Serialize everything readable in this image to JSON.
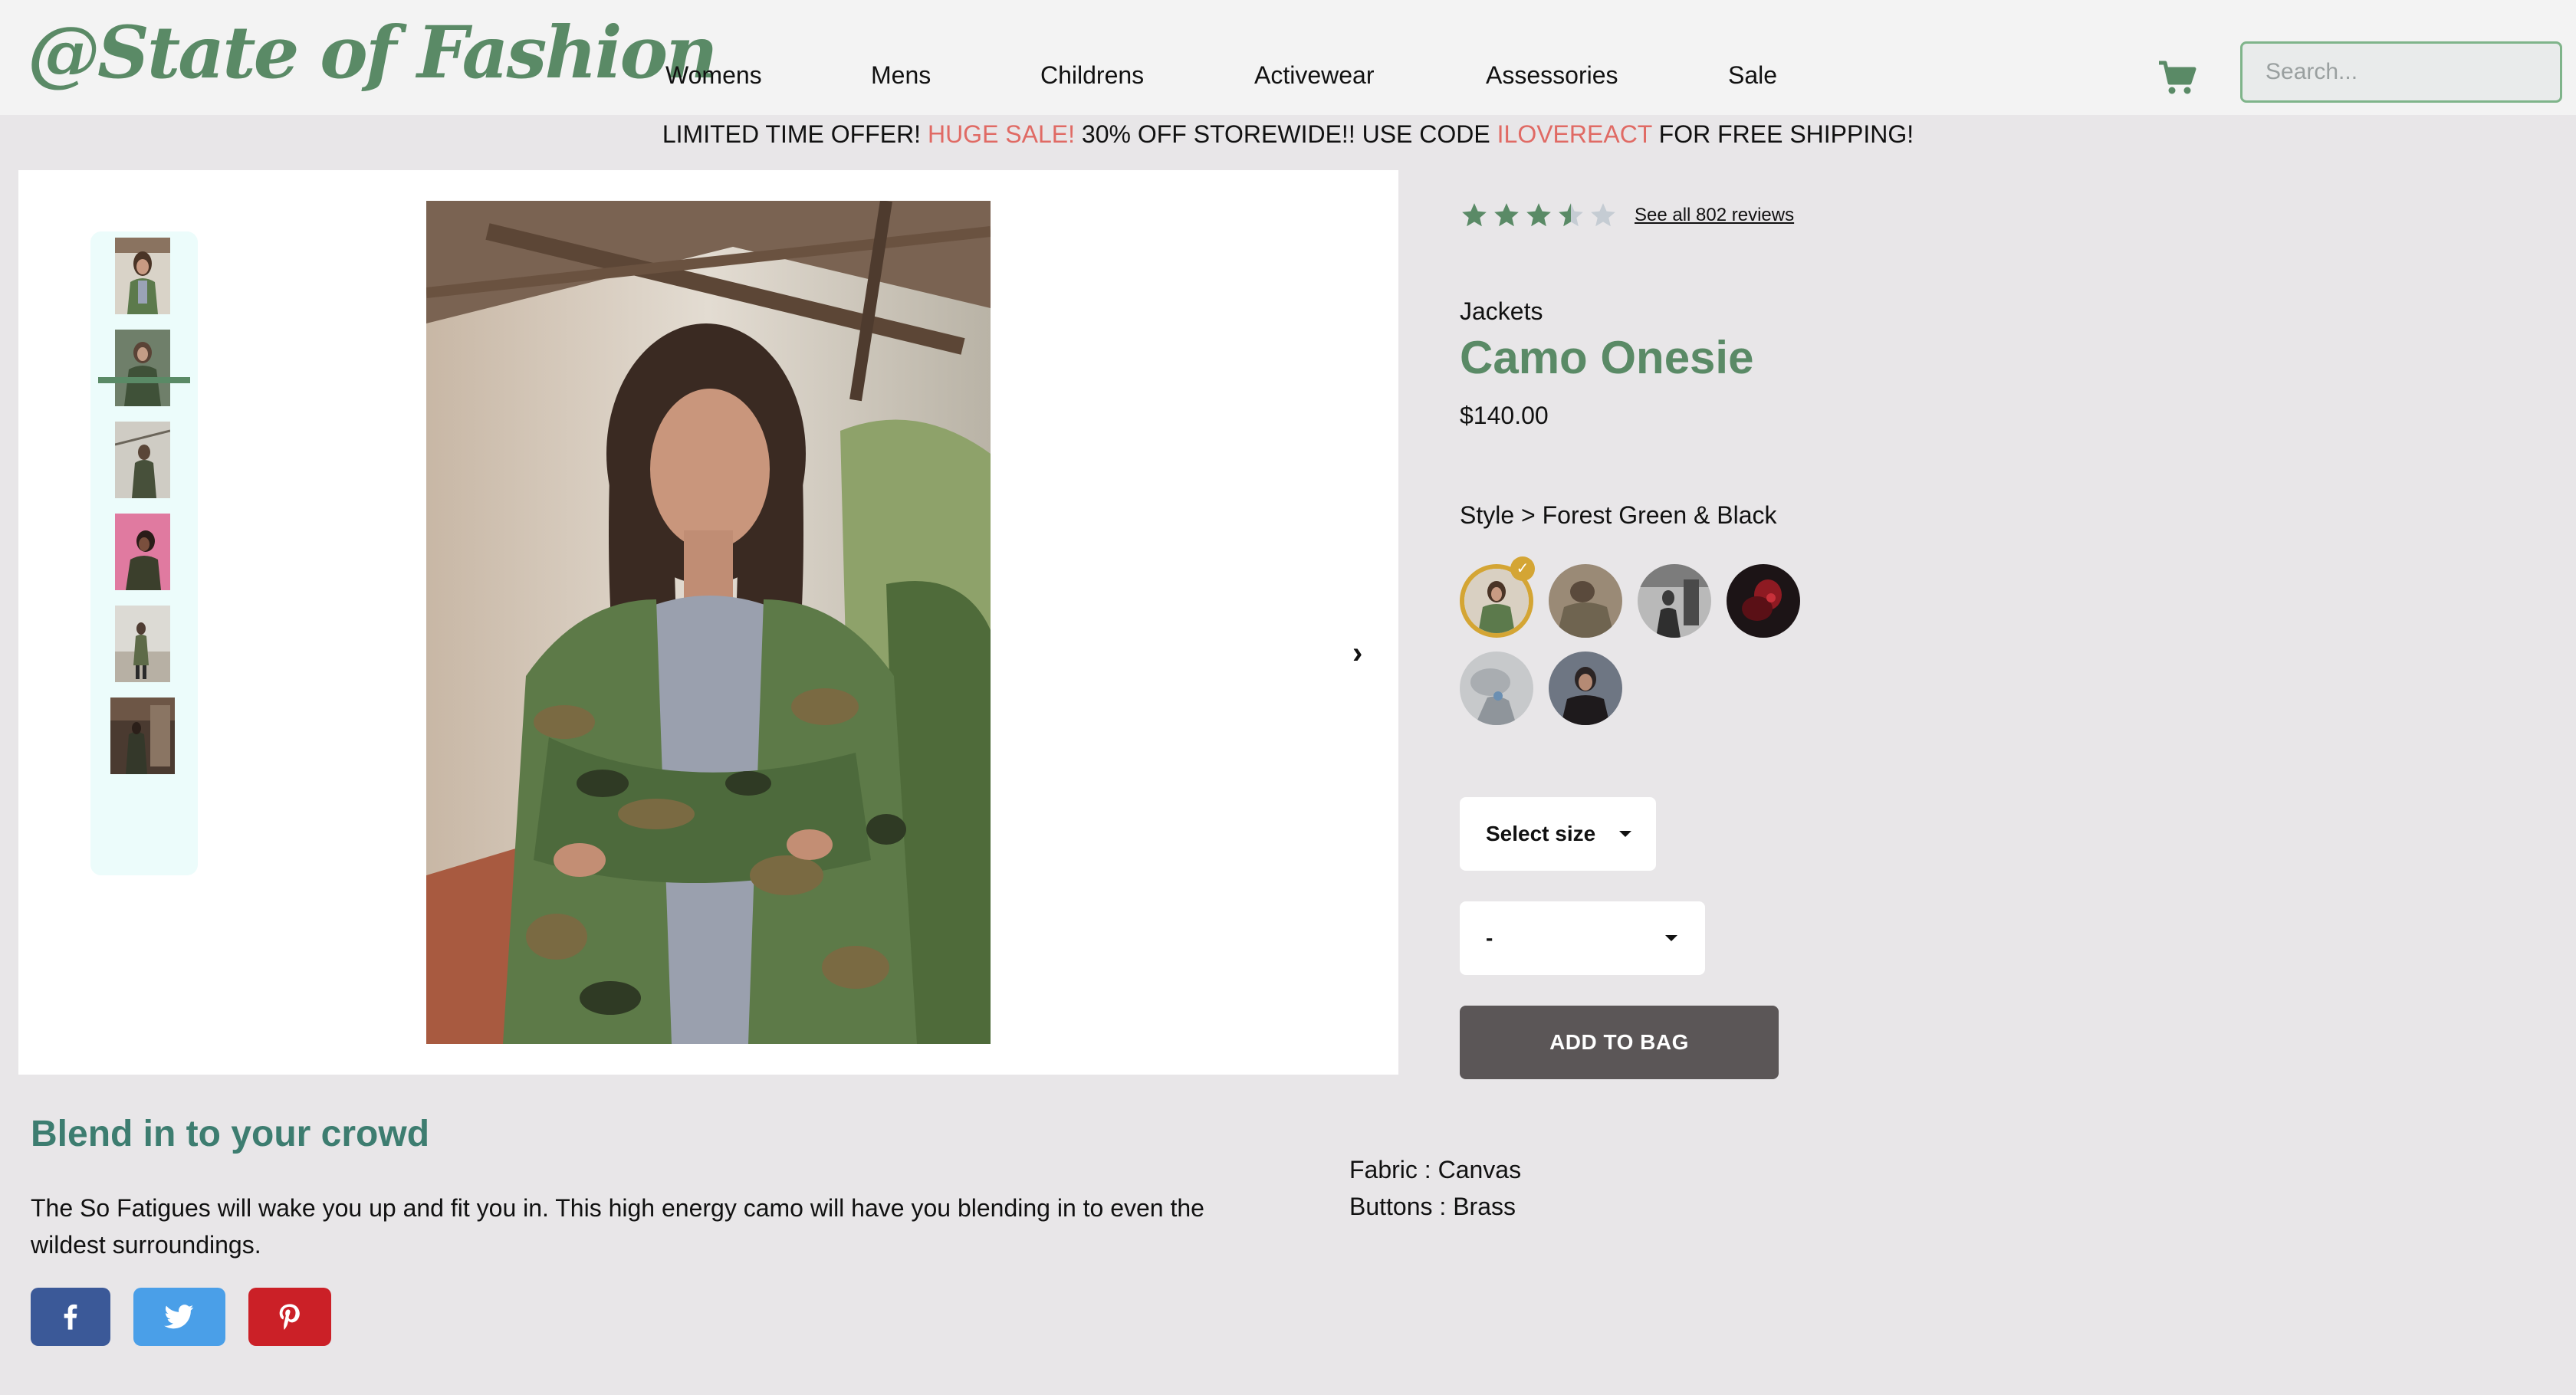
{
  "header": {
    "logo": "@State of Fashion",
    "nav": [
      "Womens",
      "Mens",
      "Childrens",
      "Activewear",
      "Assessories",
      "Sale"
    ],
    "cart_icon": "shopping-cart-icon",
    "search_placeholder": "Search..."
  },
  "banner": {
    "part1": "LIMITED TIME OFFER! ",
    "highlight1": "HUGE SALE!",
    "part2": " 30% OFF STOREWIDE!! USE CODE ",
    "highlight2": "ILOVEREACT",
    "part3": " FOR FREE SHIPPING!"
  },
  "product": {
    "rating": 3.5,
    "rating_max": 5,
    "reviews_link": "See all 802 reviews",
    "category": "Jackets",
    "name": "Camo Onesie",
    "price": "$140.00",
    "style_prefix": "Style > ",
    "style_name": "Forest Green & Black",
    "style_count": 6,
    "selected_style_index": 0,
    "thumbnail_count": 6,
    "selected_thumbnail_index": 0,
    "size_select": "Select size",
    "quantity_select": "-",
    "add_to_bag": "ADD TO BAG"
  },
  "description": {
    "title": "Blend in to your crowd",
    "text": "The So Fatigues will wake you up and fit you in. This high energy camo will have you blending in to even the wildest surroundings."
  },
  "details": [
    {
      "label": "Fabric : ",
      "value": "Canvas"
    },
    {
      "label": "Buttons : ",
      "value": "Brass"
    }
  ],
  "social": [
    {
      "icon": "facebook-icon",
      "color": "#3b5998"
    },
    {
      "icon": "twitter-icon",
      "color": "#4a9fe8"
    },
    {
      "icon": "pinterest-icon",
      "color": "#cb2027"
    }
  ],
  "colors": {
    "brand": "#5a8a66",
    "accent_red": "#e06a64",
    "selected_swatch": "#d4a534",
    "button": "#5b5657"
  }
}
